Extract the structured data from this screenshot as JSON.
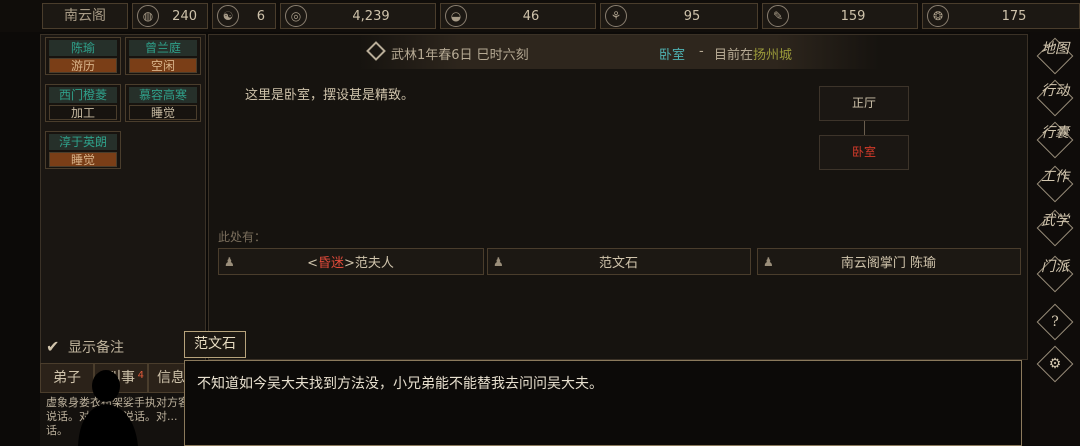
{
  "topbar": {
    "sect_name": "南云阁",
    "resources": [
      {
        "icon": "globe-icon",
        "glyph": "◍",
        "value": "240"
      },
      {
        "icon": "yinyang-icon",
        "glyph": "☯",
        "value": "6"
      },
      {
        "icon": "coin-icon",
        "glyph": "◎",
        "value": "4,239"
      },
      {
        "icon": "food-bowl-icon",
        "glyph": "◒",
        "value": "46"
      },
      {
        "icon": "herb-icon",
        "glyph": "⚘",
        "value": "95"
      },
      {
        "icon": "feather-icon",
        "glyph": "✎",
        "value": "159"
      },
      {
        "icon": "ore-icon",
        "glyph": "❂",
        "value": "175"
      }
    ]
  },
  "disciples": [
    {
      "name": "陈瑜",
      "status": "游历",
      "orange": true
    },
    {
      "name": "曾兰庭",
      "status": "空闲",
      "orange": true
    },
    {
      "name": "西门橙菱",
      "status": "加工",
      "orange": false
    },
    {
      "name": "慕容高寒",
      "status": "睡觉",
      "orange": false
    },
    {
      "name": "淳于英朗",
      "status": "睡觉",
      "orange": true
    }
  ],
  "show_memo": "显示备注",
  "lower_tabs": [
    {
      "label": "弟子"
    },
    {
      "label": "叫事",
      "badge": "4"
    },
    {
      "label": "信息"
    }
  ],
  "log_text": "虚象身娄衣布架娑手执对方客说话。对方和默说话。对...话。",
  "header": {
    "date": "武林1年春6日 巳时六刻",
    "room": "卧室",
    "separator": "-",
    "location_prefix": "目前在",
    "city": "扬州城"
  },
  "room_description": "这里是卧室，摆设甚是精致。",
  "mini_map": {
    "up": "正厅",
    "current": "卧室"
  },
  "here_label": "此处有：",
  "npcs": [
    {
      "tag_open": "<",
      "tag": "昏迷",
      "tag_close": ">",
      "name": "范夫人"
    },
    {
      "name": "范文石"
    },
    {
      "name": "南云阁掌门 陈瑜"
    }
  ],
  "right_menu": [
    {
      "label": "地图"
    },
    {
      "label": "行动"
    },
    {
      "label": "行囊"
    },
    {
      "label": "工作"
    },
    {
      "label": "武学"
    },
    {
      "label": "门派"
    },
    {
      "label": "?"
    },
    {
      "label": "⚙"
    }
  ],
  "dialog": {
    "speaker": "范文石",
    "text": "不知道如今吴大夫找到方法没，小兄弟能不能替我去问问吴大夫。"
  }
}
